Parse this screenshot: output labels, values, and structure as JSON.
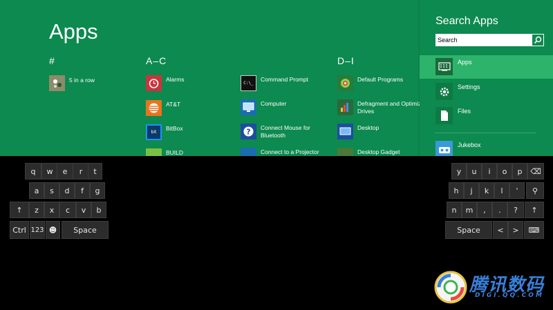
{
  "apps": {
    "title": "Apps",
    "groups": [
      {
        "header": "#",
        "items": [
          "5 in a row"
        ]
      },
      {
        "header": "A–C",
        "items": [
          "Alarms",
          "AT&T",
          "BitBox",
          "BUILD",
          "Command Prompt",
          "Computer",
          "Connect Mouse for Bluetooth",
          "Connect to a Projector"
        ]
      },
      {
        "header": "D–I",
        "items": [
          "Default Programs",
          "Defragment and Optimize Drives",
          "Desktop",
          "Desktop Gadget"
        ]
      }
    ]
  },
  "search": {
    "title": "Search Apps",
    "input_value": "Search",
    "items": [
      {
        "label": "Apps",
        "icon": "keyboard-icon"
      },
      {
        "label": "Settings",
        "icon": "gear-icon"
      },
      {
        "label": "Files",
        "icon": "file-icon"
      }
    ],
    "extra_app": "Jukebox"
  },
  "keyboard": {
    "left": {
      "row1": [
        "q",
        "w",
        "e",
        "r",
        "t"
      ],
      "row2": [
        "a",
        "s",
        "d",
        "f",
        "g"
      ],
      "row3": [
        "↑",
        "z",
        "x",
        "c",
        "v",
        "b"
      ],
      "row4": [
        "Ctrl",
        "123",
        "☻",
        "Space"
      ]
    },
    "right": {
      "row1": [
        "y",
        "u",
        "i",
        "o",
        "p",
        "⌫"
      ],
      "row2": [
        "h",
        "j",
        "k",
        "l",
        "'",
        "⚲"
      ],
      "row3": [
        "n",
        "m",
        ",",
        ".",
        "?",
        "↑"
      ],
      "row4": [
        "Space",
        "<",
        ">",
        "⌨"
      ]
    }
  },
  "watermark": {
    "text": "腾讯数码",
    "sub": "DIGI.QQ.COM"
  },
  "colors": {
    "background_green": "#0d8a4f",
    "selected_green": "#2db36b",
    "keyboard_bg": "#000000",
    "key_bg": "#2c2c2c"
  }
}
